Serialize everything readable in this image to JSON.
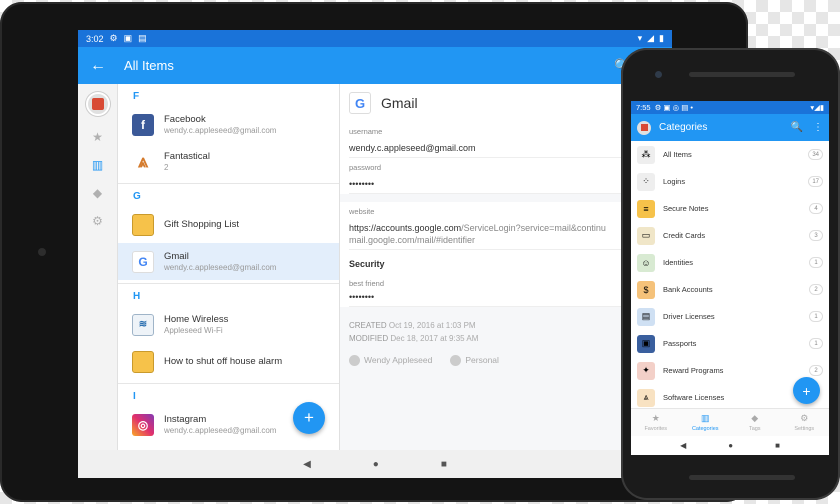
{
  "tablet": {
    "status": {
      "time": "3:02",
      "icons": [
        "⚙",
        "▣",
        "▤"
      ],
      "right_icons": [
        "▾",
        "◢",
        "▮"
      ]
    },
    "appbar": {
      "back": "←",
      "title": "All Items",
      "search": "🔍",
      "star": "★"
    },
    "rail": {
      "star": "★",
      "items": "▥",
      "tag": "◆",
      "settings": "⚙"
    },
    "list": {
      "sections": [
        {
          "letter": "F",
          "items": [
            {
              "name": "Facebook",
              "sub": "wendy.c.appleseed@gmail.com",
              "icon": "f"
            },
            {
              "name": "Fantastical",
              "sub": "2",
              "icon": "⩓"
            }
          ]
        },
        {
          "letter": "G",
          "items": [
            {
              "name": "Gift Shopping List",
              "sub": "",
              "icon": ""
            },
            {
              "name": "Gmail",
              "sub": "wendy.c.appleseed@gmail.com",
              "icon": "G"
            }
          ]
        },
        {
          "letter": "H",
          "items": [
            {
              "name": "Home Wireless",
              "sub": "Appleseed Wi-Fi",
              "icon": "≋"
            },
            {
              "name": "How to shut off house alarm",
              "sub": "",
              "icon": ""
            }
          ]
        },
        {
          "letter": "I",
          "items": [
            {
              "name": "Instagram",
              "sub": "wendy.c.appleseed@gmail.com",
              "icon": "◎"
            }
          ]
        }
      ]
    },
    "detail": {
      "logo": "G",
      "title": "Gmail",
      "username_label": "username",
      "username": "wendy.c.appleseed@gmail.com",
      "password_label": "password",
      "password": "••••••••",
      "website_label": "website",
      "website_main": "https://accounts.google.com",
      "website_rest": "/ServiceLogin?service=mail&continu",
      "website_line2": "mail.google.com/mail/#identifier",
      "security_title": "Security",
      "best_friend_label": "best friend",
      "best_friend": "••••••••",
      "created_label": "CREATED",
      "created": "Oct 19, 2016 at 1:03 PM",
      "modified_label": "MODIFIED",
      "modified": "Dec 18, 2017 at 9:35 AM",
      "owner": "Wendy Appleseed",
      "vault": "Personal"
    },
    "fab": "+",
    "nav": {
      "back": "◀",
      "home": "●",
      "recent": "■"
    }
  },
  "phone": {
    "status": {
      "time": "7:55",
      "icons": "⚙ ▣ ◎ ▤ •",
      "right_icons": "▾◢▮"
    },
    "appbar": {
      "title": "Categories",
      "search": "🔍",
      "more": "⋮"
    },
    "categories": [
      {
        "name": "All Items",
        "count": "34",
        "icon": "⁂",
        "color": "#eeeeee"
      },
      {
        "name": "Logins",
        "count": "17",
        "icon": "⁘",
        "color": "#eeeeee"
      },
      {
        "name": "Secure Notes",
        "count": "4",
        "icon": "≡",
        "color": "#f6c24a"
      },
      {
        "name": "Credit Cards",
        "count": "3",
        "icon": "▭",
        "color": "#f0e6c8"
      },
      {
        "name": "Identities",
        "count": "1",
        "icon": "☺",
        "color": "#d8ead2"
      },
      {
        "name": "Bank Accounts",
        "count": "2",
        "icon": "$",
        "color": "#f5c27a"
      },
      {
        "name": "Driver Licenses",
        "count": "1",
        "icon": "▤",
        "color": "#cfe0f3"
      },
      {
        "name": "Passports",
        "count": "1",
        "icon": "▣",
        "color": "#3a5f9e"
      },
      {
        "name": "Reward Programs",
        "count": "2",
        "icon": "✦",
        "color": "#f3d0c8"
      },
      {
        "name": "Software Licenses",
        "count": "",
        "icon": "⩓",
        "color": "#f8e2c2"
      }
    ],
    "tabs": [
      {
        "label": "Favorites",
        "icon": "★"
      },
      {
        "label": "Categories",
        "icon": "▥"
      },
      {
        "label": "Tags",
        "icon": "◆"
      },
      {
        "label": "Settings",
        "icon": "⚙"
      }
    ],
    "fab": "+",
    "nav": {
      "back": "◀",
      "home": "●",
      "recent": "■"
    }
  }
}
